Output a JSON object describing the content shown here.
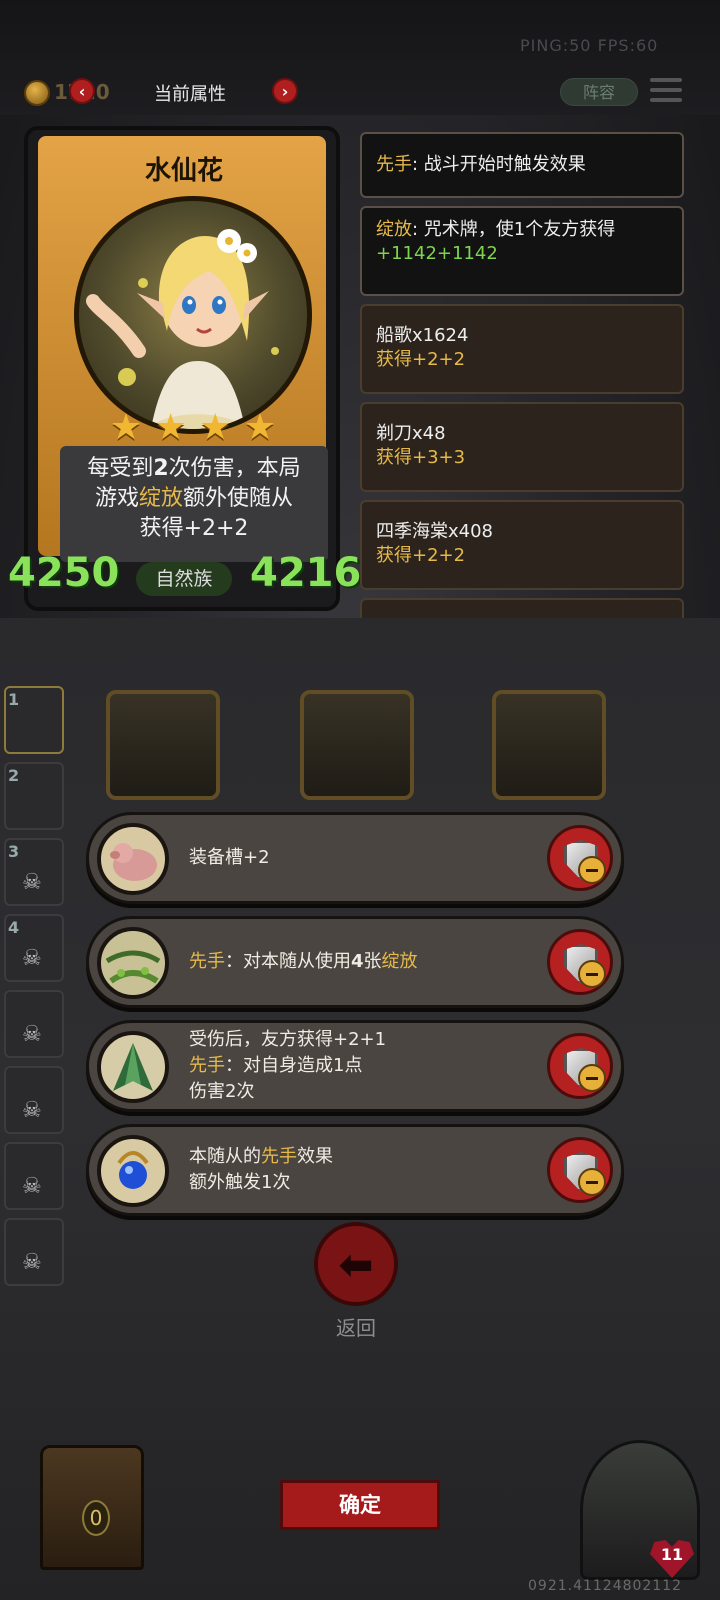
{
  "topbar": {
    "ping_fps": "PING:50  FPS:60",
    "coins": "1720",
    "title": "当前属性",
    "lineup_label": "阵容",
    "prev_icon": "chevron-left-icon",
    "next_icon": "chevron-right-icon"
  },
  "card": {
    "name": "水仙花",
    "stars": 4,
    "desc_line1_a": "每受到",
    "desc_line1_b": "2",
    "desc_line1_c": "次伤害，本局",
    "desc_line2_a": "游戏",
    "desc_line2_b": "绽放",
    "desc_line2_c": "额外使随从",
    "desc_line3": "获得+2+2",
    "attack": "4250",
    "tribe": "自然族",
    "health": "4216"
  },
  "effects": [
    {
      "keyword": "先手",
      "text": ": 战斗开始时触发效果"
    },
    {
      "keyword": "绽放",
      "text": ": 咒术牌，使1个友方获得",
      "sub": "+1142+1142"
    },
    {
      "title": "船歌x1624",
      "sub": "获得+2+2"
    },
    {
      "title": "剃刀x48",
      "sub": "获得+3+3"
    },
    {
      "title": "四季海棠x408",
      "sub": "获得+2+2"
    }
  ],
  "sidebar": {
    "slots": [
      "1",
      "2",
      "3",
      "4"
    ]
  },
  "equipment": [
    {
      "lines": [
        "装备槽+2"
      ]
    },
    {
      "keyword": "先手",
      "text": "：对本随从使用",
      "count": "4",
      "text2": "张",
      "keyword2": "绽放"
    },
    {
      "l1": "受伤后，友方获得+2+1",
      "l2_kw": "先手",
      "l2": "：对自身造成1点",
      "l3": "伤害2次"
    },
    {
      "l1a": "本随从的",
      "l1kw": "先手",
      "l1b": "效果",
      "l2": "额外触发1次"
    }
  ],
  "bottom": {
    "back_label": "返回",
    "confirm_label": "确定",
    "chest_count": "0",
    "hero_hp": "11",
    "serial": "0921.41124802112"
  },
  "colors": {
    "accent_gold": "#e6b948",
    "stat_green": "#8ae25a",
    "button_red": "#a51b1b"
  }
}
